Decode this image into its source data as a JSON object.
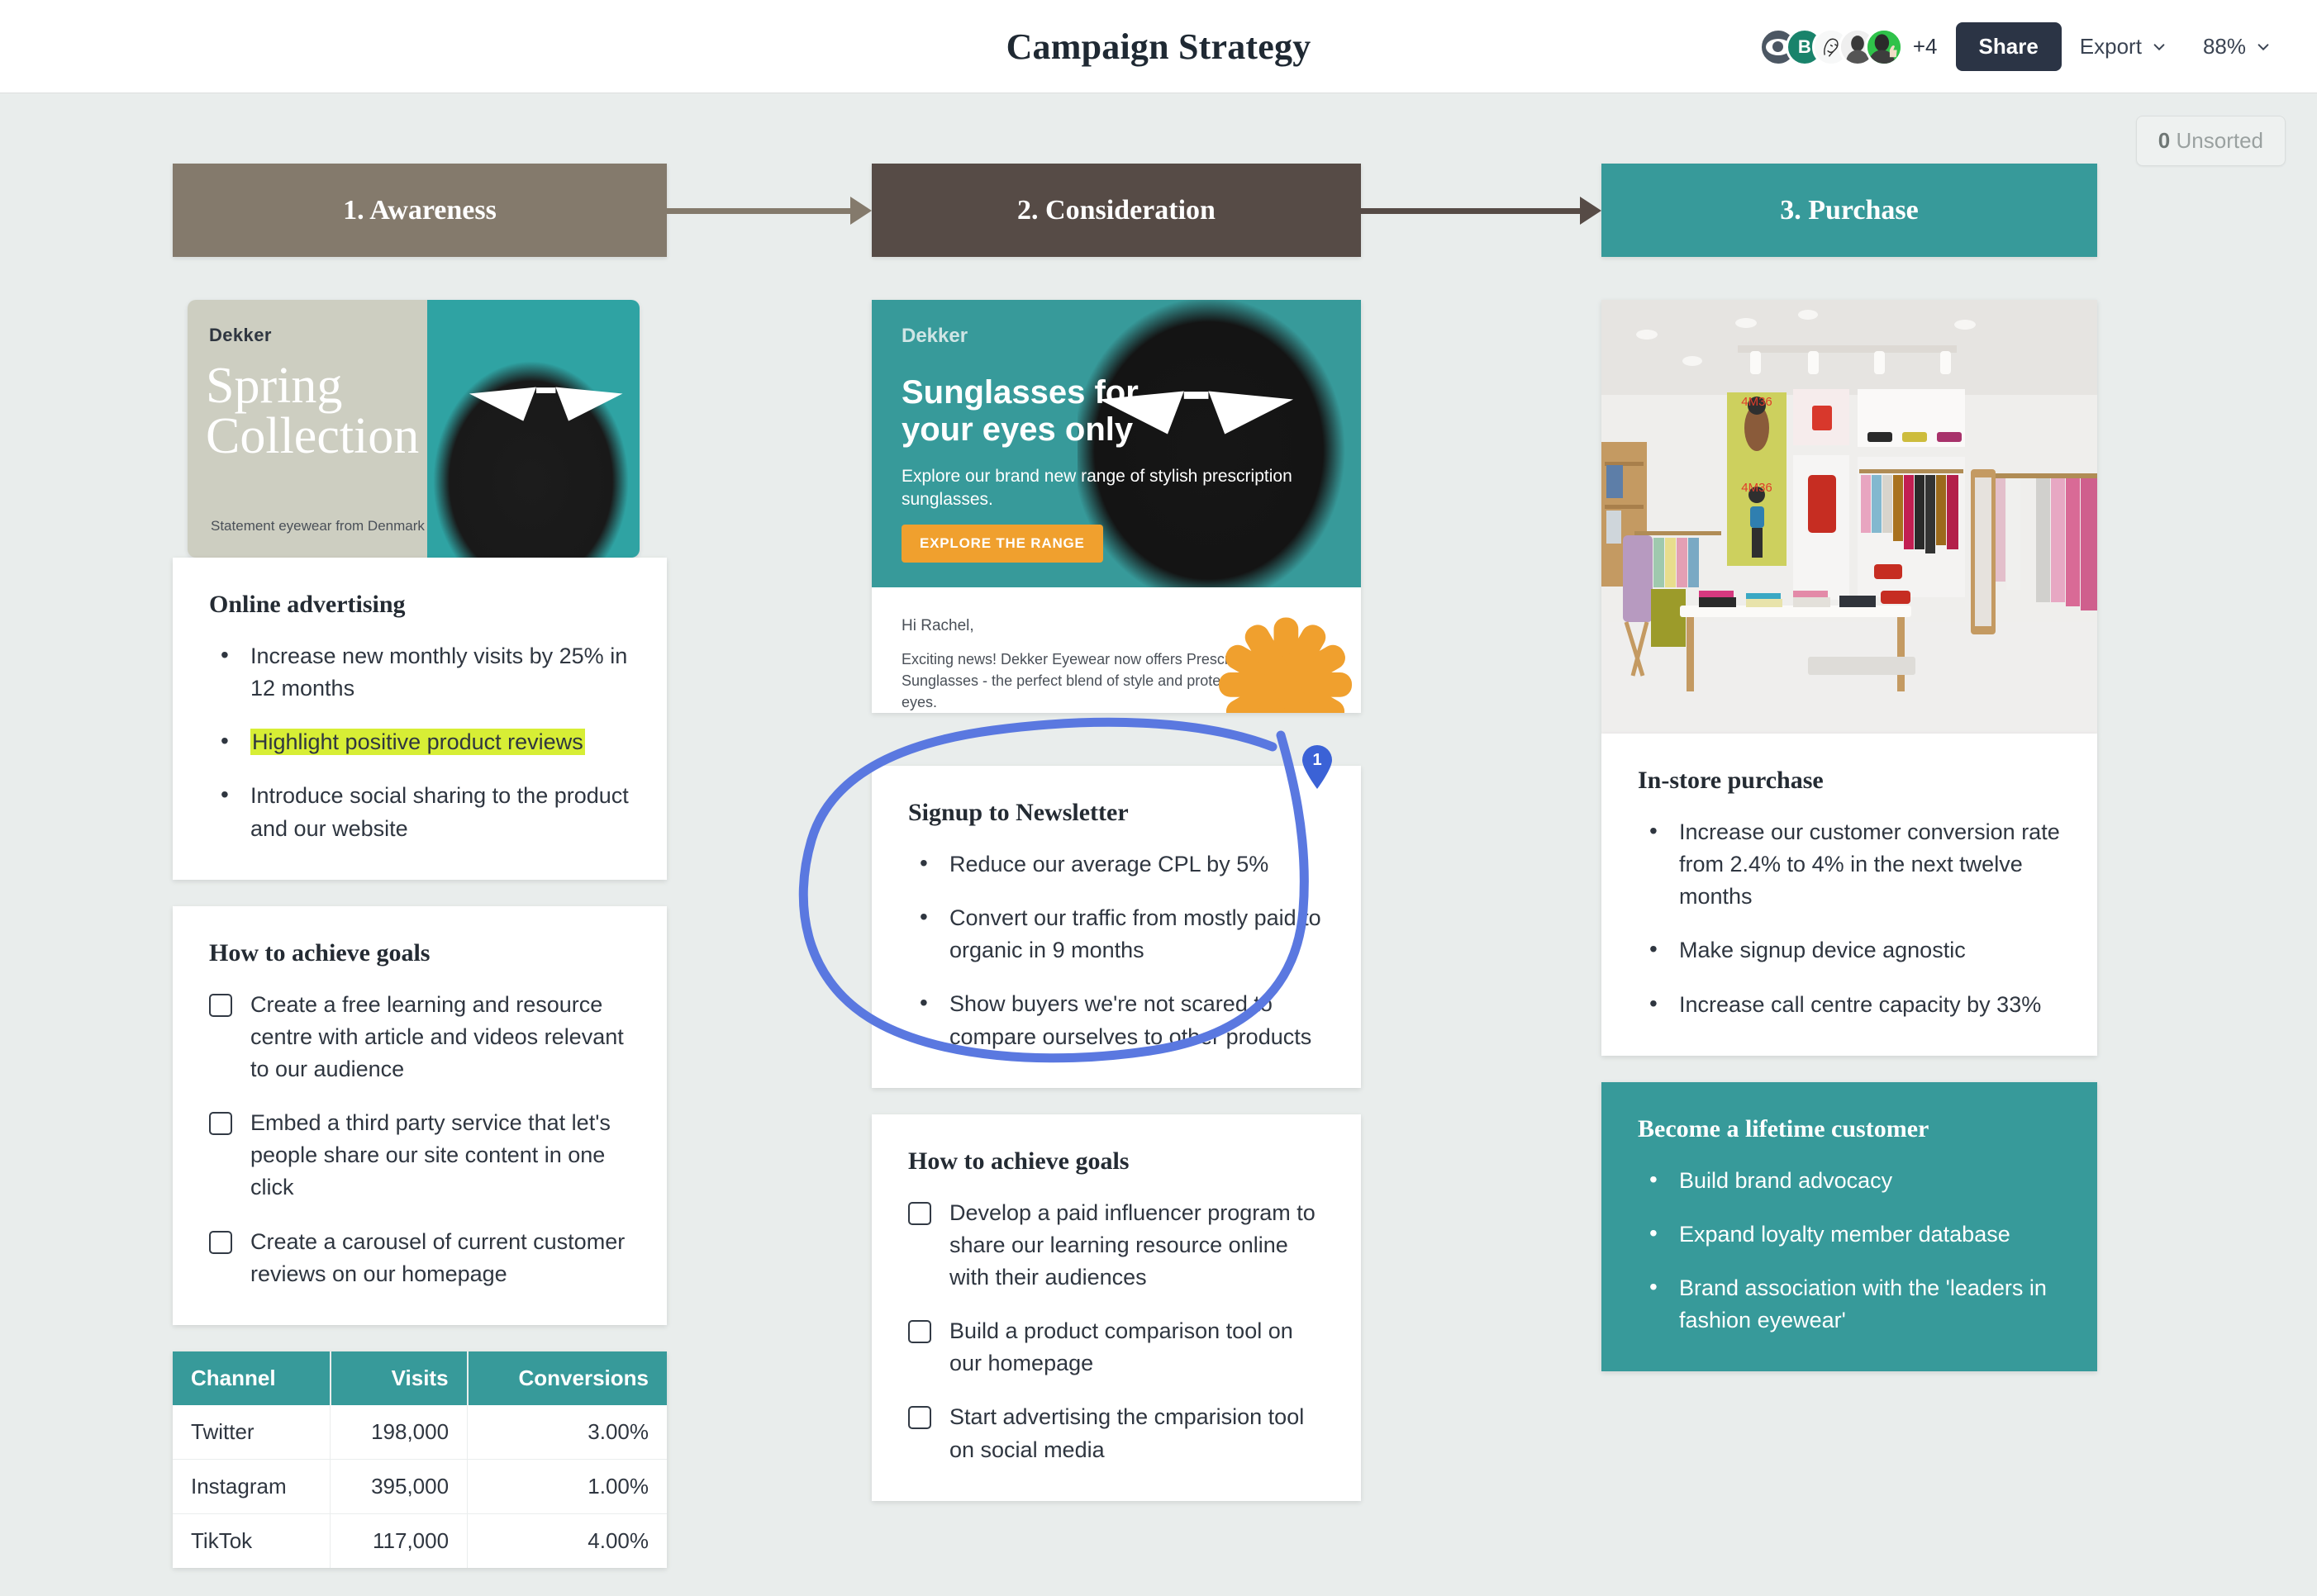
{
  "topbar": {
    "doc_title": "Campaign Strategy",
    "avatars": [
      {
        "name": "avatar-eye",
        "initial": "",
        "color": "#4c5763"
      },
      {
        "name": "avatar-b",
        "initial": "B",
        "color": "#19836b"
      },
      {
        "name": "avatar-sketch",
        "initial": "",
        "color": "#f4f5f5"
      },
      {
        "name": "avatar-photo",
        "initial": "",
        "color": "#e9eaea"
      },
      {
        "name": "avatar-thumbsup",
        "initial": "",
        "color": "#2fc24a"
      }
    ],
    "avatar_overflow": "+4",
    "share_label": "Share",
    "export_label": "Export",
    "zoom_label": "88%"
  },
  "canvas": {
    "unsorted_count": "0",
    "unsorted_label": "Unsorted"
  },
  "stages": [
    {
      "label": "1. Awareness",
      "color": "#847a6c"
    },
    {
      "label": "2. Consideration",
      "color": "#564b46"
    },
    {
      "label": "3. Purchase",
      "color": "#379a9a"
    }
  ],
  "ads": {
    "spring": {
      "brand": "Dekker",
      "line1": "Spring",
      "line2": "Collection",
      "tagline": "Statement eyewear from Denmark"
    },
    "email": {
      "brand": "Dekker",
      "headline_1": "Sunglasses for",
      "headline_2": "your eyes only",
      "lede": "Explore our brand new range of stylish prescription sunglasses.",
      "cta": "EXPLORE THE RANGE",
      "greeting": "Hi Rachel,",
      "paragraph": "Exciting news! Dekker Eyewear now offers Prescription Sunglasses - the perfect blend of style and protection for your eyes."
    }
  },
  "columns": [
    {
      "id": "awareness",
      "cards": [
        {
          "title": "Online advertising",
          "type": "bullets",
          "items": [
            {
              "text": "Increase new monthly visits by 25% in 12 months",
              "highlight": false
            },
            {
              "text": "Highlight positive product reviews",
              "highlight": true
            },
            {
              "text": "Introduce social sharing to the product and our website",
              "highlight": false
            }
          ]
        },
        {
          "title": "How to achieve goals",
          "type": "checklist",
          "items": [
            {
              "text": "Create a free learning and resource centre with article and videos relevant to our audience",
              "checked": false
            },
            {
              "text": "Embed a third party service that let's people share our site content in one click",
              "checked": false
            },
            {
              "text": "Create a carousel of current  customer reviews on our homepage",
              "checked": false
            }
          ]
        }
      ]
    },
    {
      "id": "consideration",
      "cards": [
        {
          "title": "Signup to Newsletter",
          "type": "bullets",
          "annotated": true,
          "pin_number": "1",
          "items": [
            {
              "text": "Reduce our average CPL by 5%",
              "highlight": false
            },
            {
              "text": "Convert our traffic from mostly paid to organic in 9 months",
              "highlight": false
            },
            {
              "text": "Show buyers we're not scared to compare ourselves to other products",
              "highlight": false
            }
          ]
        },
        {
          "title": "How to achieve goals",
          "type": "checklist",
          "items": [
            {
              "text": "Develop a paid influencer program to share our learning resource online with their audiences",
              "checked": false
            },
            {
              "text": "Build a product comparison tool on our homepage",
              "checked": false
            },
            {
              "text": "Start advertising the cmparision tool on social media",
              "checked": false
            }
          ]
        }
      ]
    },
    {
      "id": "purchase",
      "cards": [
        {
          "title": "In-store purchase",
          "type": "bullets",
          "items": [
            {
              "text": "Increase our customer conversion rate from 2.4% to 4% in the next twelve months",
              "highlight": false
            },
            {
              "text": "Make signup device agnostic",
              "highlight": false
            },
            {
              "text": "Increase call centre capacity by 33%",
              "highlight": false
            }
          ]
        },
        {
          "title": "Become a lifetime customer",
          "type": "bullets",
          "theme": "teal",
          "items": [
            {
              "text": "Build brand advocacy",
              "highlight": false
            },
            {
              "text": "Expand loyalty member database",
              "highlight": false
            },
            {
              "text": "Brand association with the 'leaders in fashion eyewear'",
              "highlight": false
            }
          ]
        }
      ]
    }
  ],
  "channel_table": {
    "headers": [
      "Channel",
      "Visits",
      "Conversions"
    ],
    "rows": [
      [
        "Twitter",
        "198,000",
        "3.00%"
      ],
      [
        "Instagram",
        "395,000",
        "1.00%"
      ],
      [
        "TikTok",
        "117,000",
        "4.00%"
      ]
    ]
  },
  "colors": {
    "stage_awareness": "#847a6c",
    "stage_consideration": "#564b46",
    "stage_purchase": "#379a9a",
    "accent_teal": "#379a9a",
    "highlight_yellow": "#d7ee35",
    "annotation_blue": "#5a78e0",
    "canvas_bg": "#e9edec"
  }
}
